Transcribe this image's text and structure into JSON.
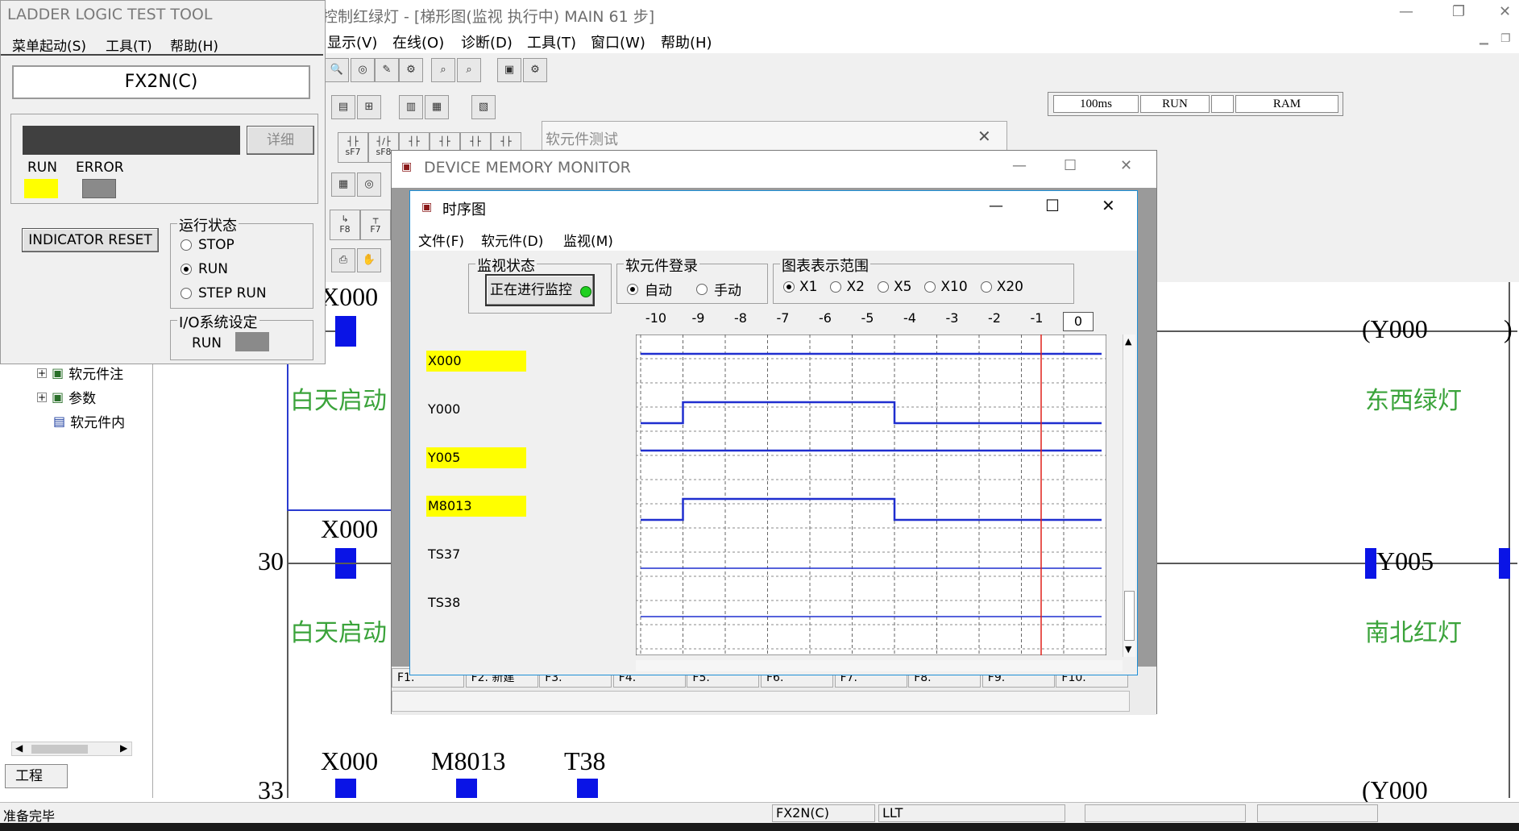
{
  "main": {
    "title": "控制红绿灯 - [梯形图(监视 执行中)    MAIN    61 步]",
    "menu": [
      "显示(V)",
      "在线(O)",
      "诊断(D)",
      "工具(T)",
      "窗口(W)",
      "帮助(H)"
    ],
    "status_strip": [
      "100ms",
      "RUN",
      "",
      "RAM"
    ],
    "fkeys": [
      "sF7",
      "sF8",
      "F8",
      "F7"
    ]
  },
  "ladder": {
    "rungs": [
      {
        "step": "",
        "contact": "X000",
        "comment": "白天启动",
        "coil": "Y000",
        "coil_comment": "东西绿灯"
      },
      {
        "step": "30",
        "contact": "X000",
        "comment": "白天启动",
        "coil": "Y005",
        "coil_comment": "南北红灯"
      },
      {
        "step": "33",
        "contacts": [
          "X000",
          "M8013",
          "T38"
        ],
        "coil": "Y000"
      }
    ]
  },
  "tree": {
    "items": [
      "软元件注",
      "参数",
      "软元件内"
    ],
    "tab": "工程"
  },
  "statusbar": {
    "ready": "准备完毕",
    "plc": "FX2N(C)",
    "mode": "LLT"
  },
  "llt": {
    "title": "LADDER LOGIC TEST TOOL",
    "menu": [
      "菜单起动(S)",
      "工具(T)",
      "帮助(H)"
    ],
    "plc_name": "FX2N(C)",
    "detail_button": "详细",
    "run_label": "RUN",
    "error_label": "ERROR",
    "indicator_reset": "INDICATOR RESET",
    "run_state_title": "运行状态",
    "run_state_options": [
      "STOP",
      "RUN",
      "STEP RUN"
    ],
    "run_state_selected": "RUN",
    "io_title": "I/O系统设定",
    "io_run_label": "RUN",
    "colors": {
      "run": "#ffff00",
      "error": "#8a8a8a"
    }
  },
  "soft_element_test": {
    "title": "软元件测试"
  },
  "dmm": {
    "title": "DEVICE MEMORY MONITOR",
    "bottom_keys": [
      "F1.",
      "F2. 新建",
      "F3.",
      "F4.",
      "F5.",
      "F6.",
      "F7.",
      "F8.",
      "F9.",
      "F10."
    ]
  },
  "timing": {
    "title": "时序图",
    "menu": [
      "文件(F)",
      "软元件(D)",
      "监视(M)"
    ],
    "monitor_group": "监视状态",
    "monitor_button": "正在进行监控",
    "device_reg_group": "软元件登录",
    "device_reg_options": [
      "自动",
      "手动"
    ],
    "device_reg_selected": "自动",
    "range_group": "图表表示范围",
    "range_options": [
      "X1",
      "X2",
      "X5",
      "X10",
      "X20"
    ],
    "range_selected": "X1",
    "ticks": [
      "-10",
      "-9",
      "-8",
      "-7",
      "-6",
      "-5",
      "-4",
      "-3",
      "-2",
      "-1"
    ],
    "current_tick": "0",
    "devices": [
      {
        "name": "X000",
        "highlight": true,
        "kind": "bit",
        "state": "high"
      },
      {
        "name": "Y000",
        "highlight": false,
        "kind": "bit",
        "pulse_from": -9.0,
        "pulse_to": -4.0
      },
      {
        "name": "Y005",
        "highlight": true,
        "kind": "bit",
        "state": "high"
      },
      {
        "name": "M8013",
        "highlight": true,
        "kind": "bit",
        "pulse_from": -9.0,
        "pulse_to": -4.0
      },
      {
        "name": "TS37",
        "highlight": false,
        "kind": "bit",
        "state": "low"
      },
      {
        "name": "TS38",
        "highlight": false,
        "kind": "bit",
        "state": "low"
      }
    ],
    "colors": {
      "signal": "#1f2ecf",
      "cursor": "#e0201a",
      "grid": "#666666"
    }
  }
}
